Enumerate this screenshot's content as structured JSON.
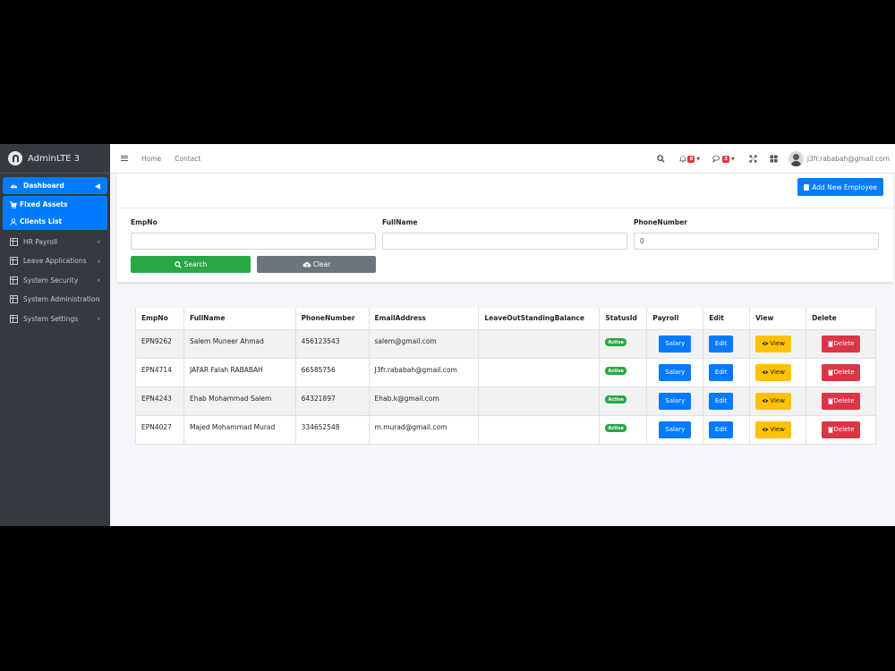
{
  "brand": {
    "title": "AdminLTE 3"
  },
  "sidebar": {
    "dashboard": "Dashboard",
    "sub_items": [
      "Fixed Assets",
      "Clients List"
    ],
    "items": [
      "HR Payroll",
      "Leave Applications",
      "System Security",
      "System Administration",
      "System Settings"
    ]
  },
  "topbar": {
    "links": [
      "Home",
      "Contact"
    ],
    "notifications_count": "8",
    "messages_count": "3",
    "user_email": "j3fr.rababah@gmail.com"
  },
  "search": {
    "add_button": "Add New Employee",
    "labels": {
      "empno": "EmpNo",
      "fullname": "FullName",
      "phone": "PhoneNumber"
    },
    "values": {
      "empno": "",
      "fullname": "",
      "phone": "0"
    },
    "search_button": "Search",
    "clear_button": "Clear"
  },
  "table": {
    "headers": [
      "EmpNo",
      "FullName",
      "PhoneNumber",
      "EmailAddress",
      "LeaveOutStandingBalance",
      "StatusId",
      "Payroll",
      "Edit",
      "View",
      "Delete"
    ],
    "rows": [
      {
        "empno": "EPN9262",
        "fullname": "Salem Muneer Ahmad",
        "phone": "456123543",
        "email": "salem@gmail.com",
        "balance": "",
        "status": "Active",
        "payroll": "Salary",
        "edit": "Edit",
        "view": "View",
        "delete": "Delete"
      },
      {
        "empno": "EPN4714",
        "fullname": "JAFAR Falah RABABAH",
        "phone": "66585756",
        "email": "J3fr.rababah@gmail.com",
        "balance": "",
        "status": "Active",
        "payroll": "Salary",
        "edit": "Edit",
        "view": "View",
        "delete": "Delete"
      },
      {
        "empno": "EPN4243",
        "fullname": "Ehab Mohammad Salem",
        "phone": "64321897",
        "email": "Ehab.k@gmail.com",
        "balance": "",
        "status": "Active",
        "payroll": "Salary",
        "edit": "Edit",
        "view": "View",
        "delete": "Delete"
      },
      {
        "empno": "EPN4027",
        "fullname": "Majed Mohammad Murad",
        "phone": "334652548",
        "email": "m.murad@gmail.com",
        "balance": "",
        "status": "Active",
        "payroll": "Salary",
        "edit": "Edit",
        "view": "View",
        "delete": "Delete"
      }
    ]
  }
}
